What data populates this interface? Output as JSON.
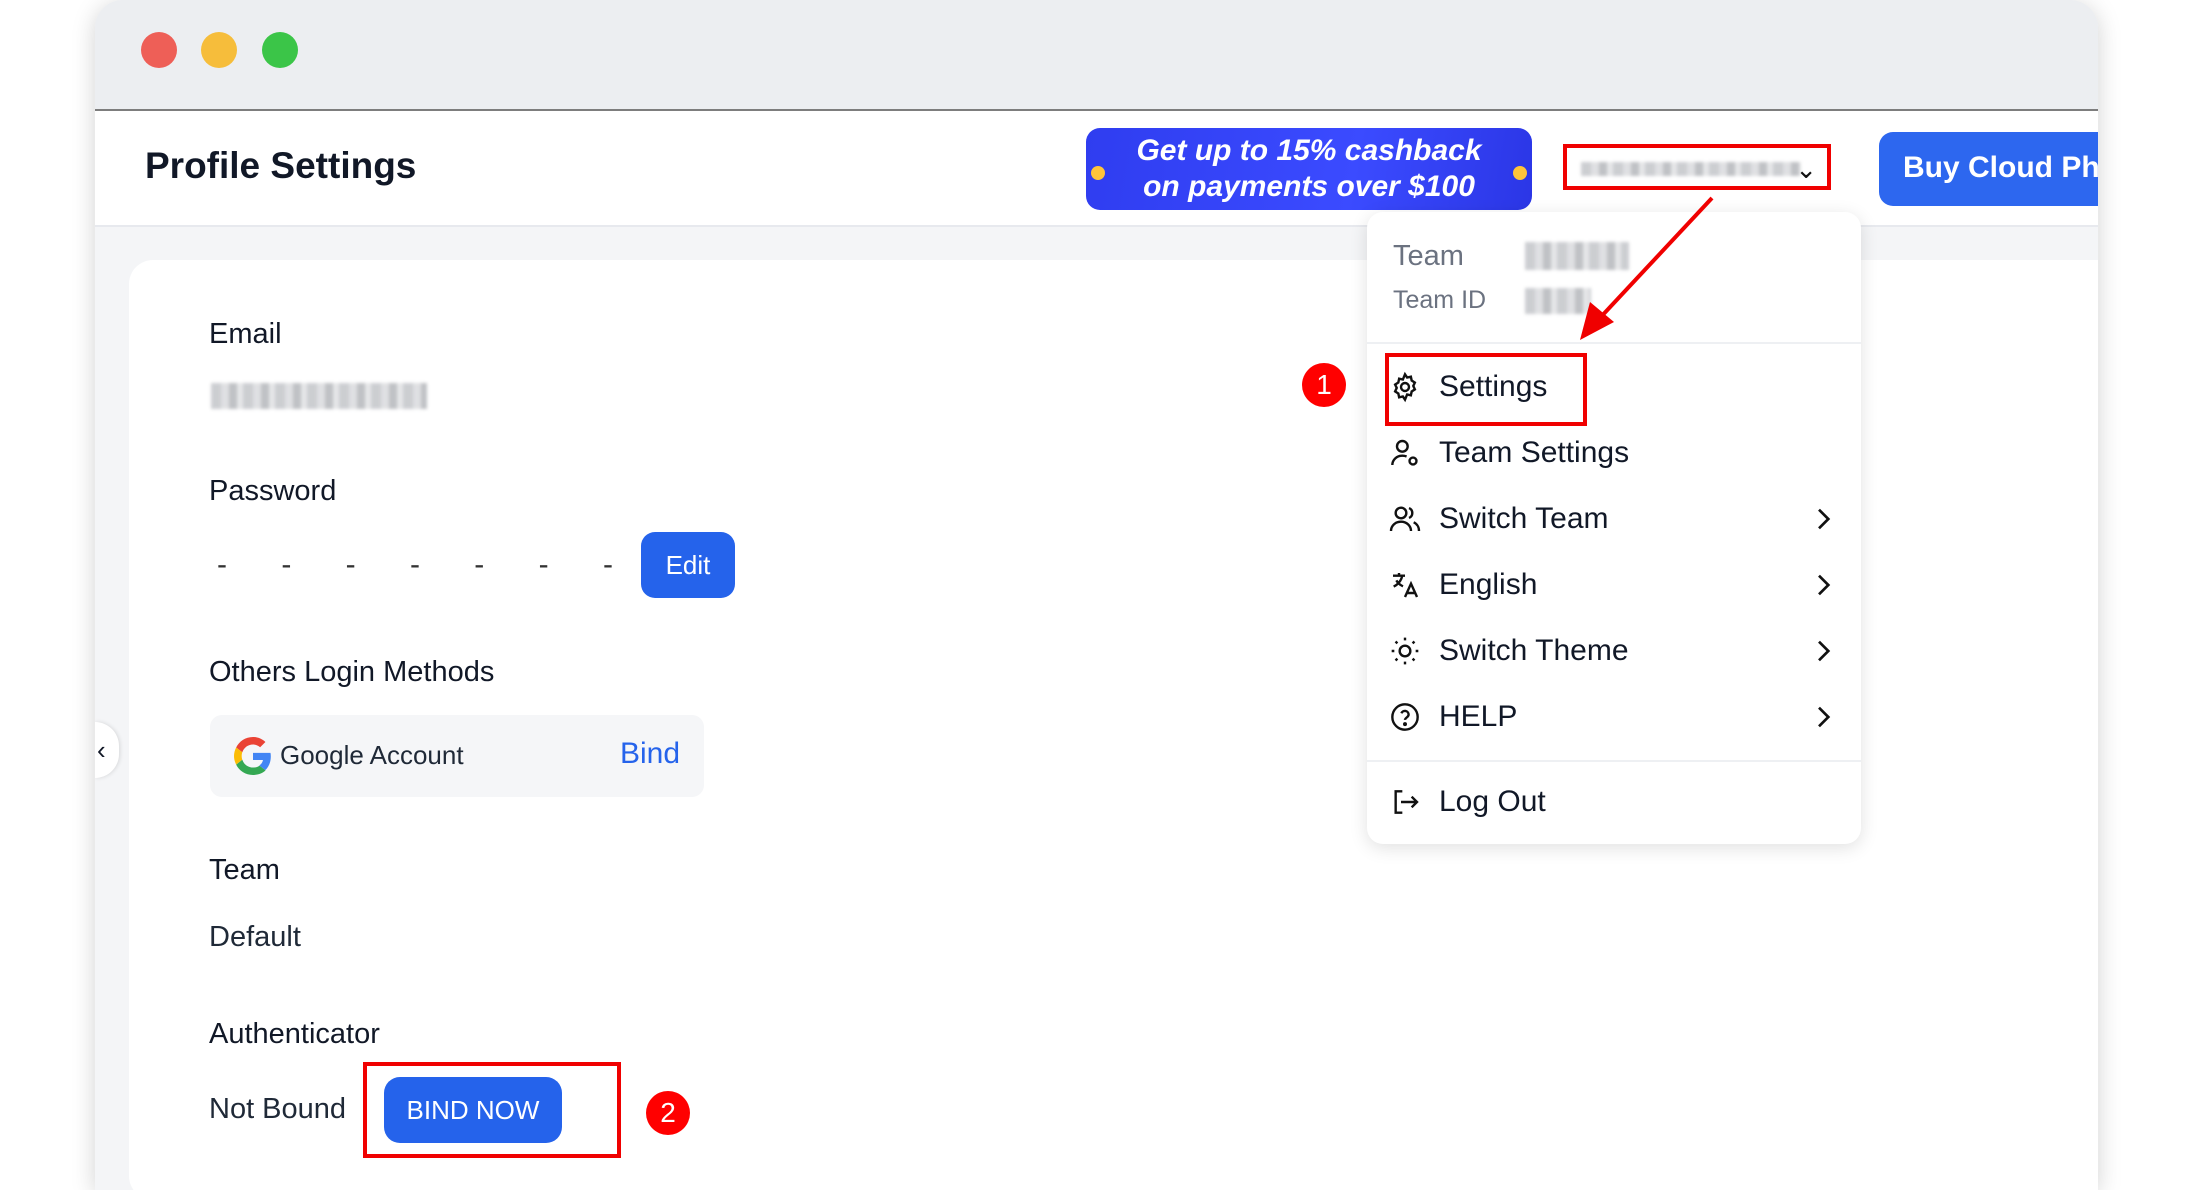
{
  "window": {
    "controls": [
      "close-button",
      "minimize-button",
      "zoom-button"
    ]
  },
  "header": {
    "title": "Profile Settings",
    "promo": {
      "line1": "Get up to 15% cashback",
      "line2": "on payments over $100"
    },
    "buy_button": "Buy Cloud Pho"
  },
  "profile": {
    "email_label": "Email",
    "password_label": "Password",
    "password_mask": "- - - - - - - -",
    "edit_button": "Edit",
    "login_methods_label": "Others Login Methods",
    "google_account": "Google Account",
    "bind_link": "Bind",
    "team_label": "Team",
    "team_value": "Default",
    "authenticator_label": "Authenticator",
    "authenticator_status": "Not Bound",
    "bind_now_button": "BIND NOW"
  },
  "menu": {
    "team_label": "Team",
    "team_id_label": "Team ID",
    "items": [
      {
        "label": "Settings",
        "icon": "gear-icon"
      },
      {
        "label": "Team Settings",
        "icon": "user-gear-icon"
      },
      {
        "label": "Switch Team",
        "icon": "users-icon"
      },
      {
        "label": "English",
        "icon": "translate-icon"
      },
      {
        "label": "Switch Theme",
        "icon": "sun-icon"
      },
      {
        "label": "HELP",
        "icon": "help-circle-icon"
      },
      {
        "label": "Log Out",
        "icon": "logout-icon"
      }
    ]
  },
  "annotations": {
    "marker1": "1",
    "marker2": "2",
    "highlight_color": "#f00000"
  },
  "colors": {
    "primary": "#2563eb",
    "promo": "#3b4bff",
    "accent_red": "#ff0000"
  }
}
